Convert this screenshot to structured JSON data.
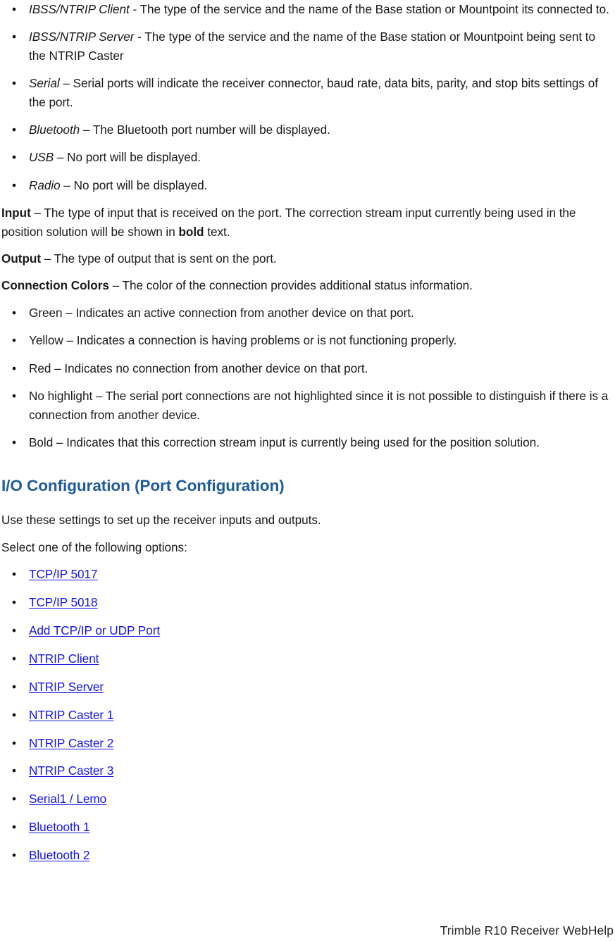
{
  "page": {
    "footer_text": "Trimble R10 Receiver WebHelp"
  },
  "colors": {
    "heading_blue": "#1F5C99",
    "link_blue": "#1414E6",
    "body_text": "#1A1A1A"
  },
  "port_type_bullets": [
    {
      "lead": "IBSS/NTRIP Client",
      "lead_style": "italic",
      "separator": " - ",
      "text": "The type of the service and the name of the Base station or Mountpoint its connected to."
    },
    {
      "lead": "IBSS/NTRIP Server",
      "lead_style": "italic",
      "separator": " - ",
      "text": "The type of the service and the name of the Base station or Mountpoint being sent to the NTRIP Caster"
    },
    {
      "lead": "Serial",
      "lead_style": "italic",
      "separator": " – ",
      "text": "Serial ports will indicate the receiver connector, baud rate, data bits, parity, and stop bits settings of the port."
    },
    {
      "lead": "Bluetooth",
      "lead_style": "italic",
      "separator": " – ",
      "text": "The Bluetooth port number will be displayed."
    },
    {
      "lead": "USB",
      "lead_style": "italic",
      "separator": " – ",
      "text": "No port will be displayed."
    },
    {
      "lead": "Radio",
      "lead_style": "italic",
      "separator": " – ",
      "text": "No port will be displayed."
    }
  ],
  "input_para": {
    "lead": "Input",
    "separator": " – ",
    "text_before_bold": "The type of input that is received on the port. The correction stream input currently being used in the position solution will be shown in ",
    "bold_word": "bold",
    "text_after_bold": " text."
  },
  "output_para": {
    "lead": "Output",
    "separator": " – ",
    "text": "The type of output that is sent on the port."
  },
  "connection_colors_para": {
    "lead": "Connection Colors",
    "separator": " – ",
    "text": "The color of the connection provides additional status information."
  },
  "connection_color_bullets": [
    {
      "lead": "Green",
      "separator": " – ",
      "text": "Indicates an active connection from another device on that port."
    },
    {
      "lead": "Yellow",
      "separator": " – ",
      "text": "Indicates a connection is having problems or is not functioning properly."
    },
    {
      "lead": "Red",
      "separator": " – ",
      "text": "Indicates no connection from another device on that port."
    },
    {
      "lead": "No highlight",
      "separator": " – ",
      "text": "The serial port connections are not highlighted since it is not possible to distinguish if there is a connection from another device."
    },
    {
      "lead": "Bold",
      "separator": " – ",
      "text": "Indicates that this correction stream input is currently being used for the position solution."
    }
  ],
  "section": {
    "heading": "I/O Configuration (Port Configuration)",
    "intro_line_1": "Use these settings to set up the receiver inputs and outputs.",
    "intro_line_2": "Select one of the following options:"
  },
  "option_links": [
    {
      "label": "TCP/IP 5017"
    },
    {
      "label": "TCP/IP 5018"
    },
    {
      "label": "Add TCP/IP or UDP Port"
    },
    {
      "label": "NTRIP Client"
    },
    {
      "label": "NTRIP Server"
    },
    {
      "label": "NTRIP Caster 1"
    },
    {
      "label": "NTRIP Caster 2"
    },
    {
      "label": "NTRIP Caster 3"
    },
    {
      "label": "Serial1 / Lemo"
    },
    {
      "label": "Bluetooth 1"
    },
    {
      "label": "Bluetooth 2"
    }
  ]
}
